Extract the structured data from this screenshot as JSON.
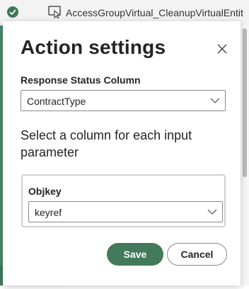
{
  "background": {
    "flow_title": "AccessGroupVirtual_CleanupVirtualEntit",
    "bottom_fragment": "................"
  },
  "dialog": {
    "title": "Action settings",
    "close_icon": "close-icon",
    "response_status": {
      "label": "Response Status Column",
      "selected": "ContractType"
    },
    "instructions": "Select a column for each input parameter",
    "parameters": [
      {
        "name": "Objkey",
        "selected": "keyref"
      }
    ],
    "buttons": {
      "save": "Save",
      "cancel": "Cancel"
    }
  },
  "colors": {
    "accent": "#427a5b",
    "status_icon": "#3a7a55"
  }
}
